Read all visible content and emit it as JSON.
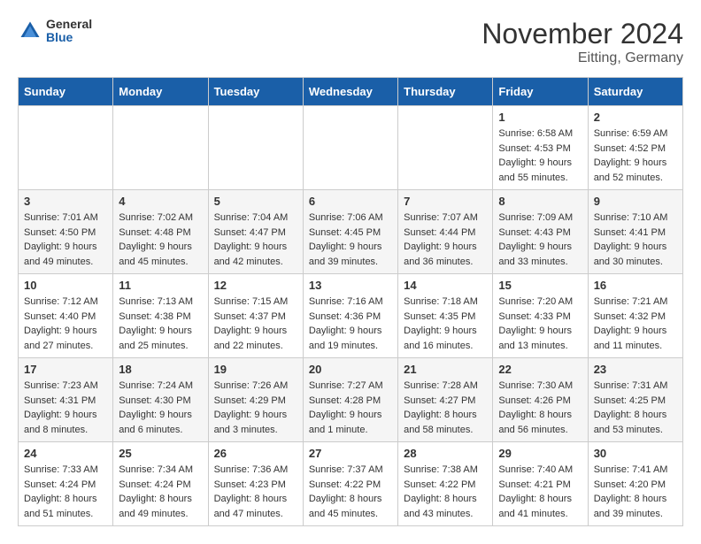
{
  "logo": {
    "general": "General",
    "blue": "Blue"
  },
  "title": "November 2024",
  "location": "Eitting, Germany",
  "weekdays": [
    "Sunday",
    "Monday",
    "Tuesday",
    "Wednesday",
    "Thursday",
    "Friday",
    "Saturday"
  ],
  "weeks": [
    [
      {
        "day": "",
        "sunrise": "",
        "sunset": "",
        "daylight": ""
      },
      {
        "day": "",
        "sunrise": "",
        "sunset": "",
        "daylight": ""
      },
      {
        "day": "",
        "sunrise": "",
        "sunset": "",
        "daylight": ""
      },
      {
        "day": "",
        "sunrise": "",
        "sunset": "",
        "daylight": ""
      },
      {
        "day": "",
        "sunrise": "",
        "sunset": "",
        "daylight": ""
      },
      {
        "day": "1",
        "sunrise": "Sunrise: 6:58 AM",
        "sunset": "Sunset: 4:53 PM",
        "daylight": "Daylight: 9 hours and 55 minutes."
      },
      {
        "day": "2",
        "sunrise": "Sunrise: 6:59 AM",
        "sunset": "Sunset: 4:52 PM",
        "daylight": "Daylight: 9 hours and 52 minutes."
      }
    ],
    [
      {
        "day": "3",
        "sunrise": "Sunrise: 7:01 AM",
        "sunset": "Sunset: 4:50 PM",
        "daylight": "Daylight: 9 hours and 49 minutes."
      },
      {
        "day": "4",
        "sunrise": "Sunrise: 7:02 AM",
        "sunset": "Sunset: 4:48 PM",
        "daylight": "Daylight: 9 hours and 45 minutes."
      },
      {
        "day": "5",
        "sunrise": "Sunrise: 7:04 AM",
        "sunset": "Sunset: 4:47 PM",
        "daylight": "Daylight: 9 hours and 42 minutes."
      },
      {
        "day": "6",
        "sunrise": "Sunrise: 7:06 AM",
        "sunset": "Sunset: 4:45 PM",
        "daylight": "Daylight: 9 hours and 39 minutes."
      },
      {
        "day": "7",
        "sunrise": "Sunrise: 7:07 AM",
        "sunset": "Sunset: 4:44 PM",
        "daylight": "Daylight: 9 hours and 36 minutes."
      },
      {
        "day": "8",
        "sunrise": "Sunrise: 7:09 AM",
        "sunset": "Sunset: 4:43 PM",
        "daylight": "Daylight: 9 hours and 33 minutes."
      },
      {
        "day": "9",
        "sunrise": "Sunrise: 7:10 AM",
        "sunset": "Sunset: 4:41 PM",
        "daylight": "Daylight: 9 hours and 30 minutes."
      }
    ],
    [
      {
        "day": "10",
        "sunrise": "Sunrise: 7:12 AM",
        "sunset": "Sunset: 4:40 PM",
        "daylight": "Daylight: 9 hours and 27 minutes."
      },
      {
        "day": "11",
        "sunrise": "Sunrise: 7:13 AM",
        "sunset": "Sunset: 4:38 PM",
        "daylight": "Daylight: 9 hours and 25 minutes."
      },
      {
        "day": "12",
        "sunrise": "Sunrise: 7:15 AM",
        "sunset": "Sunset: 4:37 PM",
        "daylight": "Daylight: 9 hours and 22 minutes."
      },
      {
        "day": "13",
        "sunrise": "Sunrise: 7:16 AM",
        "sunset": "Sunset: 4:36 PM",
        "daylight": "Daylight: 9 hours and 19 minutes."
      },
      {
        "day": "14",
        "sunrise": "Sunrise: 7:18 AM",
        "sunset": "Sunset: 4:35 PM",
        "daylight": "Daylight: 9 hours and 16 minutes."
      },
      {
        "day": "15",
        "sunrise": "Sunrise: 7:20 AM",
        "sunset": "Sunset: 4:33 PM",
        "daylight": "Daylight: 9 hours and 13 minutes."
      },
      {
        "day": "16",
        "sunrise": "Sunrise: 7:21 AM",
        "sunset": "Sunset: 4:32 PM",
        "daylight": "Daylight: 9 hours and 11 minutes."
      }
    ],
    [
      {
        "day": "17",
        "sunrise": "Sunrise: 7:23 AM",
        "sunset": "Sunset: 4:31 PM",
        "daylight": "Daylight: 9 hours and 8 minutes."
      },
      {
        "day": "18",
        "sunrise": "Sunrise: 7:24 AM",
        "sunset": "Sunset: 4:30 PM",
        "daylight": "Daylight: 9 hours and 6 minutes."
      },
      {
        "day": "19",
        "sunrise": "Sunrise: 7:26 AM",
        "sunset": "Sunset: 4:29 PM",
        "daylight": "Daylight: 9 hours and 3 minutes."
      },
      {
        "day": "20",
        "sunrise": "Sunrise: 7:27 AM",
        "sunset": "Sunset: 4:28 PM",
        "daylight": "Daylight: 9 hours and 1 minute."
      },
      {
        "day": "21",
        "sunrise": "Sunrise: 7:28 AM",
        "sunset": "Sunset: 4:27 PM",
        "daylight": "Daylight: 8 hours and 58 minutes."
      },
      {
        "day": "22",
        "sunrise": "Sunrise: 7:30 AM",
        "sunset": "Sunset: 4:26 PM",
        "daylight": "Daylight: 8 hours and 56 minutes."
      },
      {
        "day": "23",
        "sunrise": "Sunrise: 7:31 AM",
        "sunset": "Sunset: 4:25 PM",
        "daylight": "Daylight: 8 hours and 53 minutes."
      }
    ],
    [
      {
        "day": "24",
        "sunrise": "Sunrise: 7:33 AM",
        "sunset": "Sunset: 4:24 PM",
        "daylight": "Daylight: 8 hours and 51 minutes."
      },
      {
        "day": "25",
        "sunrise": "Sunrise: 7:34 AM",
        "sunset": "Sunset: 4:24 PM",
        "daylight": "Daylight: 8 hours and 49 minutes."
      },
      {
        "day": "26",
        "sunrise": "Sunrise: 7:36 AM",
        "sunset": "Sunset: 4:23 PM",
        "daylight": "Daylight: 8 hours and 47 minutes."
      },
      {
        "day": "27",
        "sunrise": "Sunrise: 7:37 AM",
        "sunset": "Sunset: 4:22 PM",
        "daylight": "Daylight: 8 hours and 45 minutes."
      },
      {
        "day": "28",
        "sunrise": "Sunrise: 7:38 AM",
        "sunset": "Sunset: 4:22 PM",
        "daylight": "Daylight: 8 hours and 43 minutes."
      },
      {
        "day": "29",
        "sunrise": "Sunrise: 7:40 AM",
        "sunset": "Sunset: 4:21 PM",
        "daylight": "Daylight: 8 hours and 41 minutes."
      },
      {
        "day": "30",
        "sunrise": "Sunrise: 7:41 AM",
        "sunset": "Sunset: 4:20 PM",
        "daylight": "Daylight: 8 hours and 39 minutes."
      }
    ]
  ]
}
